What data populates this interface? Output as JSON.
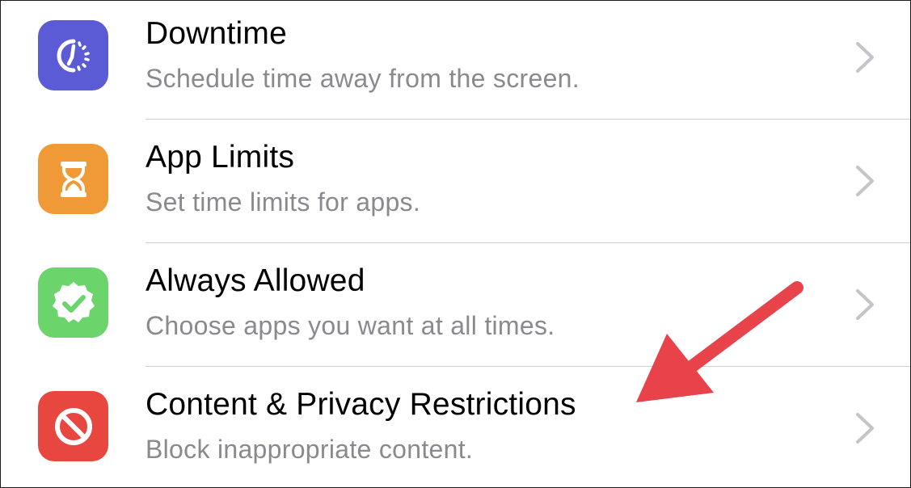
{
  "settings_list": {
    "items": [
      {
        "id": "downtime",
        "icon": "downtime-icon",
        "icon_color": "#5b5bd6",
        "title": "Downtime",
        "subtitle": "Schedule time away from the screen."
      },
      {
        "id": "app-limits",
        "icon": "hourglass-icon",
        "icon_color": "#f09a37",
        "title": "App Limits",
        "subtitle": "Set time limits for apps."
      },
      {
        "id": "always-allowed",
        "icon": "checkmark-badge-icon",
        "icon_color": "#6bd46b",
        "title": "Always Allowed",
        "subtitle": "Choose apps you want at all times."
      },
      {
        "id": "content-privacy",
        "icon": "prohibited-icon",
        "icon_color": "#e8473f",
        "title": "Content & Privacy Restrictions",
        "subtitle": "Block inappropriate content."
      }
    ]
  },
  "annotation": {
    "arrow_color": "#e8424b"
  }
}
